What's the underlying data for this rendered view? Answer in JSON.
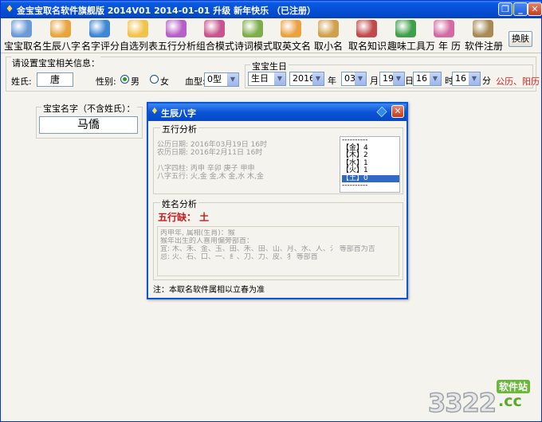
{
  "window": {
    "title": "金宝宝取名软件旗舰版 2014V01  2014-01-01 升级 新年快乐 （已注册）",
    "buttons": {
      "restore": "❐",
      "minimize": "_",
      "close": "✕"
    }
  },
  "toolbar": {
    "items": [
      {
        "label": "宝宝取名",
        "icon": "baby-icon",
        "color": "#6A9AD8"
      },
      {
        "label": "生辰八字",
        "icon": "magnifier-icon",
        "color": "#E8A53C"
      },
      {
        "label": "名字评分",
        "icon": "globe-icon",
        "color": "#3E86D6"
      },
      {
        "label": "自选列表",
        "icon": "star-icon",
        "color": "#F2C24A"
      },
      {
        "label": "五行分析",
        "icon": "gear-icon",
        "color": "#B65FC8"
      },
      {
        "label": "组合模式",
        "icon": "cards-icon",
        "color": "#C8548E"
      },
      {
        "label": "诗词模式",
        "icon": "book-icon",
        "color": "#7EAE4C"
      },
      {
        "label": "取英文名",
        "icon": "star-pen-icon",
        "color": "#E9A23E"
      },
      {
        "label": "取小名",
        "icon": "butterfly-icon",
        "color": "#D1A04C"
      },
      {
        "label": "取名知识",
        "icon": "blocks-icon",
        "color": "#C24A4A"
      },
      {
        "label": "趣味工具",
        "icon": "recycle-icon",
        "color": "#3FA04A"
      },
      {
        "label": "万年历",
        "icon": "calendar-icon",
        "color": "#D46AA2"
      },
      {
        "label": "软件注册",
        "icon": "key-icon",
        "color": "#A88A54"
      }
    ],
    "switch_skin": "换肤"
  },
  "info": {
    "legend": "请设置宝宝相关信息：",
    "surname_label": "姓氏:",
    "surname_value": "唐",
    "gender_label": "性别:",
    "gender_male": "男",
    "gender_female": "女",
    "gender_selected": "male",
    "blood_label": "血型:",
    "blood_value": "0型"
  },
  "birth": {
    "legend": "宝宝生日",
    "type_value": "生日",
    "year_value": "2016",
    "year_unit": "年",
    "month_value": "03",
    "month_unit": "月",
    "day_value": "19",
    "day_unit": "日",
    "hour_value": "16",
    "hour_unit": "时",
    "minute_value": "16",
    "minute_unit": "分",
    "calendar_note": "公历、阳历"
  },
  "baby_name": {
    "legend": "宝宝名字（不含姓氏）：",
    "value": "马僑"
  },
  "dialog": {
    "title": "生辰八字",
    "wuxing_legend": "五行分析",
    "wuxing_info": [
      "公历日期: 2016年03月19日 16时",
      "农历日期: 2016年2月11日 16时",
      "",
      "八字四柱: 丙申 辛卯 庚子 甲申",
      "八字五行: 火,金 金,木 金,水 木,金"
    ],
    "wuxing_list": [
      {
        "text": "----------",
        "selected": false
      },
      {
        "text": "【金】4",
        "selected": false
      },
      {
        "text": "【木】2",
        "selected": false
      },
      {
        "text": "【水】1",
        "selected": false
      },
      {
        "text": "【火】1",
        "selected": false
      },
      {
        "text": "【土】0",
        "selected": true
      },
      {
        "text": "----------",
        "selected": false
      }
    ],
    "name_analysis_legend": "姓名分析",
    "wx_lack": "五行缺： 土",
    "analysis_lines": [
      "丙申年, 属相(生肖)：猴",
      "猴年出生的人喜用偏旁部首：",
      "宜: 木、禾、金、玉、田、禾、田、山、月、水、人、氵 等部首为吉",
      "忌: 火、石、口、一、纟、刀、力、皮、犭 等部首"
    ],
    "note": "注：本取名软件属相以立春为准"
  },
  "watermark": {
    "digits": "3322",
    "small": "软件站",
    "cc": ".cc"
  }
}
